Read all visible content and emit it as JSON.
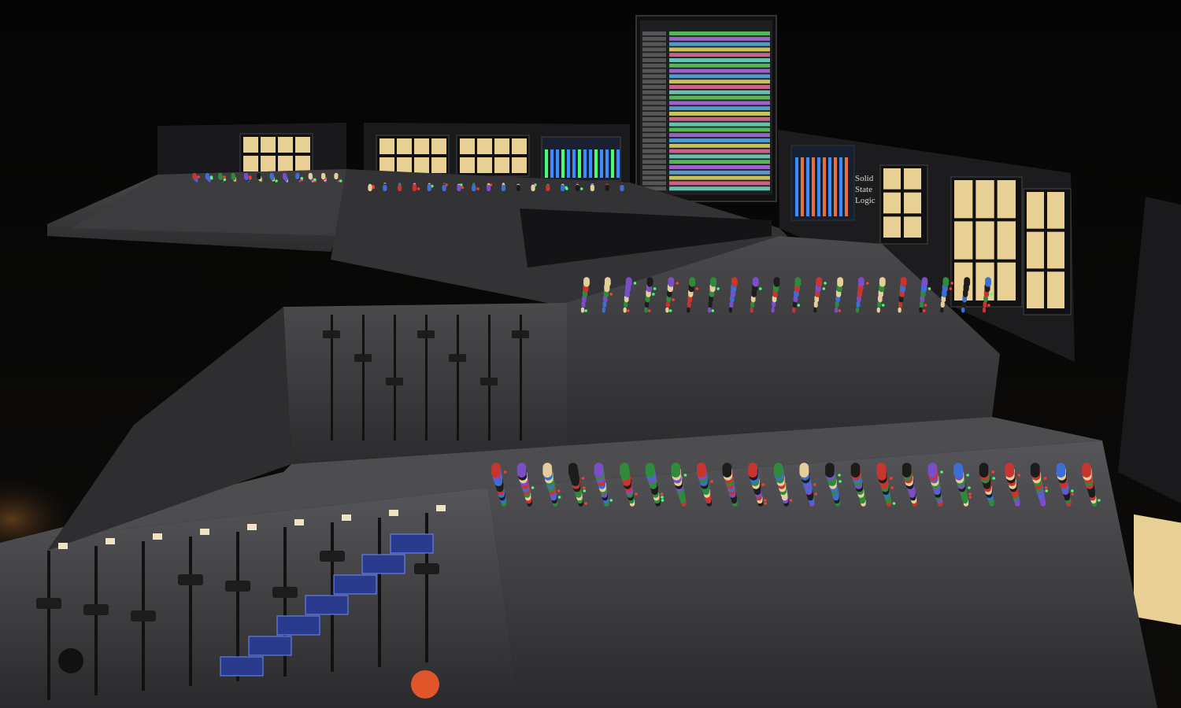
{
  "scene": {
    "subject": "large-format-mixing-console",
    "colors": {
      "background": "#050505",
      "console_body": "#3a3a3c",
      "console_dark": "#1e1e20",
      "meter_face": "#e8cf93",
      "daw_tracks": [
        "#5fd35f",
        "#b46ee8",
        "#5ab0e8",
        "#e8e060",
        "#e86f9a",
        "#6fe0c8"
      ],
      "knob_caps": [
        "#1c1c1c",
        "#c8352e",
        "#2f8a3c",
        "#3c6fd6",
        "#e4cf9c",
        "#7b4ec8"
      ],
      "led_red": "#ff3a2a",
      "led_green": "#46ff6a",
      "led_blue": "#3c8cff",
      "button_cream": "#efe3c4"
    },
    "console": {
      "brand_lettering": [
        "Solid",
        "State",
        "Logic"
      ],
      "visible_meter_screens": 10,
      "visible_daw_monitors": 1
    }
  }
}
